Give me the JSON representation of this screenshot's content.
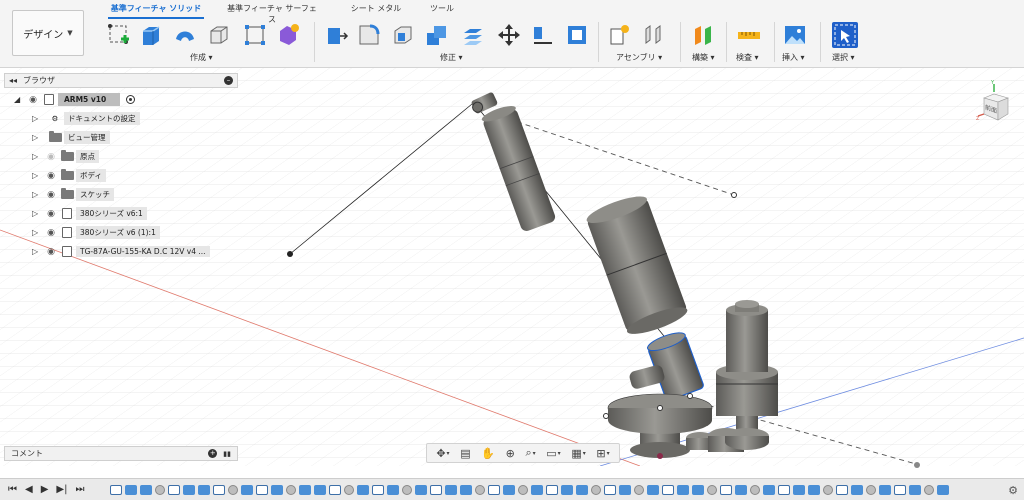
{
  "toolbar": {
    "workspace": "デザイン",
    "tabs": [
      "基準フィーチャ ソリッド",
      "基準フィーチャ サーフェス",
      "シート メタル",
      "ツール"
    ],
    "groups": [
      "作成",
      "修正",
      "アセンブリ",
      "構築",
      "検査",
      "挿入",
      "選択"
    ]
  },
  "browser": {
    "title": "ブラウザ",
    "items": [
      {
        "label": "ARM5 v10",
        "kind": "root"
      },
      {
        "label": "ドキュメントの設定",
        "kind": "gear"
      },
      {
        "label": "ビュー管理",
        "kind": "folder"
      },
      {
        "label": "原点",
        "kind": "folder"
      },
      {
        "label": "ボディ",
        "kind": "folder"
      },
      {
        "label": "スケッチ",
        "kind": "folder"
      },
      {
        "label": "380シリーズ v6:1",
        "kind": "component"
      },
      {
        "label": "380シリーズ v6 (1):1",
        "kind": "component"
      },
      {
        "label": "TG-87A-GU-155-KA D.C 12V v4 ...",
        "kind": "component"
      }
    ]
  },
  "comments": {
    "label": "コメント"
  },
  "viewcube": {
    "face": "前面"
  },
  "colors": {
    "accent": "#1a6fd1",
    "selection": "#1f5fc9",
    "model": "#7d7c78"
  },
  "icons": {
    "navbar": [
      "orbit-icon",
      "look-at-icon",
      "pan-icon",
      "zoom-icon",
      "fit-icon",
      "display-settings-icon",
      "grid-icon",
      "viewports-icon"
    ],
    "playback": [
      "first-frame-icon",
      "previous-frame-icon",
      "play-icon",
      "next-frame-icon",
      "last-frame-icon"
    ]
  }
}
